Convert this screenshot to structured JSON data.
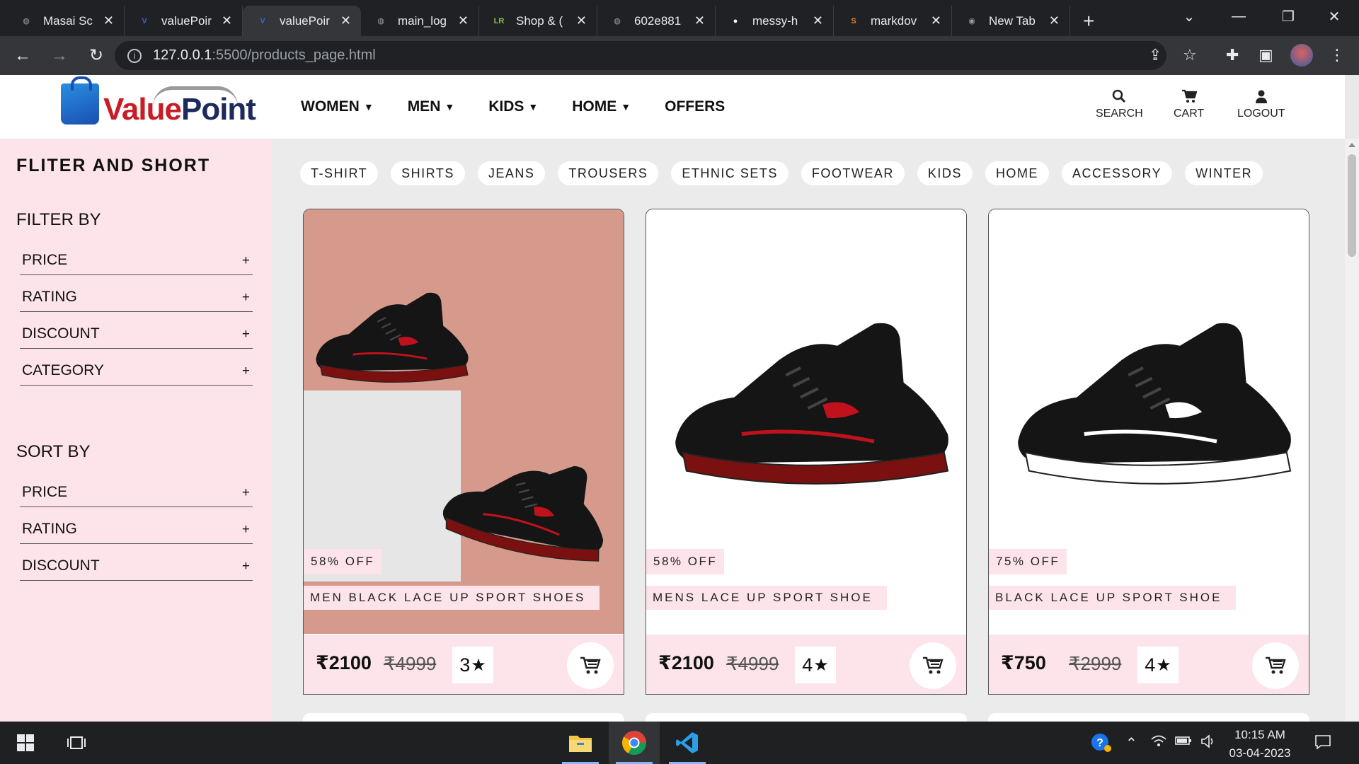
{
  "browser": {
    "tabs": [
      {
        "title": "Masai Sc",
        "fav_color": "#9aa0a6",
        "fav_glyph": "◍"
      },
      {
        "title": "valuePoir",
        "fav_color": "#3b63d6",
        "fav_glyph": "V"
      },
      {
        "title": "valuePoir",
        "fav_color": "#3b63d6",
        "fav_glyph": "V"
      },
      {
        "title": "main_log",
        "fav_color": "#9aa0a6",
        "fav_glyph": "◍"
      },
      {
        "title": "Shop & (",
        "fav_color": "#8bc34a",
        "fav_glyph": "LR"
      },
      {
        "title": "602e881",
        "fav_color": "#9aa0a6",
        "fav_glyph": "◍"
      },
      {
        "title": "messy-h",
        "fav_color": "#ffffff",
        "fav_glyph": "●"
      },
      {
        "title": "markdov",
        "fav_color": "#f48024",
        "fav_glyph": "S"
      },
      {
        "title": "New Tab",
        "fav_color": "#9aa0a6",
        "fav_glyph": "◉"
      }
    ],
    "active_tab_index": 2,
    "url_host": "127.0.0.1",
    "url_path": ":5500/products_page.html"
  },
  "header": {
    "logo_text_value": "Value",
    "logo_text_point": "Point",
    "nav": [
      {
        "label": "WOMEN",
        "has_caret": true
      },
      {
        "label": "MEN",
        "has_caret": true
      },
      {
        "label": "KIDS",
        "has_caret": true
      },
      {
        "label": "HOME",
        "has_caret": true
      },
      {
        "label": "OFFERS",
        "has_caret": false
      }
    ],
    "search_label": "SEARCH",
    "cart_label": "CART",
    "logout_label": "LOGOUT"
  },
  "sidebar": {
    "title": "FLITER AND SHORT",
    "filter_heading": "FILTER BY",
    "filters": [
      "PRICE",
      "RATING",
      "DISCOUNT",
      "CATEGORY"
    ],
    "sort_heading": "SORT BY",
    "sorts": [
      "PRICE",
      "RATING",
      "DISCOUNT"
    ],
    "expand_symbol": "+"
  },
  "categories": [
    "T-SHIRT",
    "SHIRTS",
    "JEANS",
    "TROUSERS",
    "ETHNIC SETS",
    "FOOTWEAR",
    "KIDS",
    "HOME",
    "ACCESSORY",
    "WINTER"
  ],
  "products": [
    {
      "name": "MEN BLACK LACE UP SPORT SHOES",
      "discount": "58% OFF",
      "price": "₹2100",
      "mrp": "₹4999",
      "rating": "3",
      "bg": "pink"
    },
    {
      "name": "MENS LACE UP SPORT SHOE",
      "discount": "58% OFF",
      "price": "₹2100",
      "mrp": "₹4999",
      "rating": "4",
      "bg": "white"
    },
    {
      "name": "BLACK LACE UP SPORT SHOE",
      "discount": "75% OFF",
      "price": "₹750",
      "mrp": "₹2999",
      "rating": "4",
      "bg": "white"
    }
  ],
  "taskbar": {
    "time": "10:15 AM",
    "date": "03-04-2023"
  },
  "colors": {
    "sidebar_bg": "#fde4ea",
    "brand_red": "#c81d25",
    "brand_navy": "#1f2a5c"
  }
}
